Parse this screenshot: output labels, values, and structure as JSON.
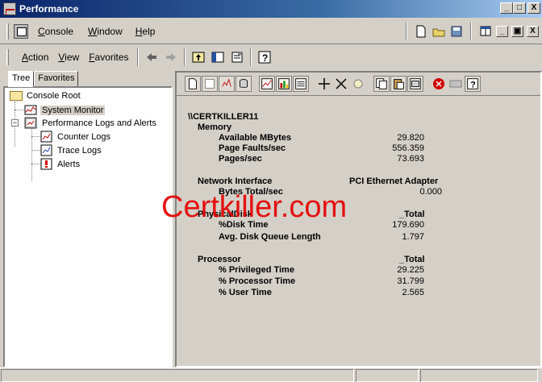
{
  "window": {
    "title": "Performance",
    "buttons": [
      "_",
      "□",
      "X"
    ]
  },
  "console_menu": {
    "items": [
      {
        "label": "Console",
        "underline": "C"
      },
      {
        "label": "Window",
        "underline": "W"
      },
      {
        "label": "Help",
        "underline": "H"
      }
    ]
  },
  "action_menu": {
    "items": [
      {
        "label": "Action",
        "underline": "A"
      },
      {
        "label": "View",
        "underline": "V"
      },
      {
        "label": "Favorites",
        "underline": "F"
      }
    ]
  },
  "tabs": [
    {
      "label": "Tree"
    },
    {
      "label": "Favorites"
    }
  ],
  "tree": [
    {
      "label": "Console Root"
    },
    {
      "label": "System Monitor"
    },
    {
      "label": "Performance Logs and Alerts"
    },
    {
      "label": "Counter Logs"
    },
    {
      "label": "Trace Logs"
    },
    {
      "label": "Alerts"
    }
  ],
  "report": {
    "computer": "\\\\CERTKILLER11",
    "memory": {
      "title": "Memory",
      "rows": [
        {
          "label": "Available MBytes",
          "value": "29.820"
        },
        {
          "label": "Page Faults/sec",
          "value": "556.359"
        },
        {
          "label": "Pages/sec",
          "value": "73.693"
        }
      ]
    },
    "network": {
      "title": "Network Interface",
      "instance": "PCI Ethernet Adapter",
      "rows": [
        {
          "label": "Bytes Total/sec",
          "value": "0.000"
        }
      ]
    },
    "disk": {
      "title": "PhysicalDisk",
      "instance": "_Total",
      "rows": [
        {
          "label": "%Disk Time",
          "value": "179.690"
        },
        {
          "label": "Avg. Disk Queue Length",
          "value": "1.797"
        }
      ]
    },
    "processor": {
      "title": "Processor",
      "instance": "_Total",
      "rows": [
        {
          "label": "% Privileged Time",
          "value": "29.225"
        },
        {
          "label": "% Processor Time",
          "value": "31.799"
        },
        {
          "label": "% User Time",
          "value": "2.565"
        }
      ]
    }
  },
  "watermark": "Certkiller.com"
}
